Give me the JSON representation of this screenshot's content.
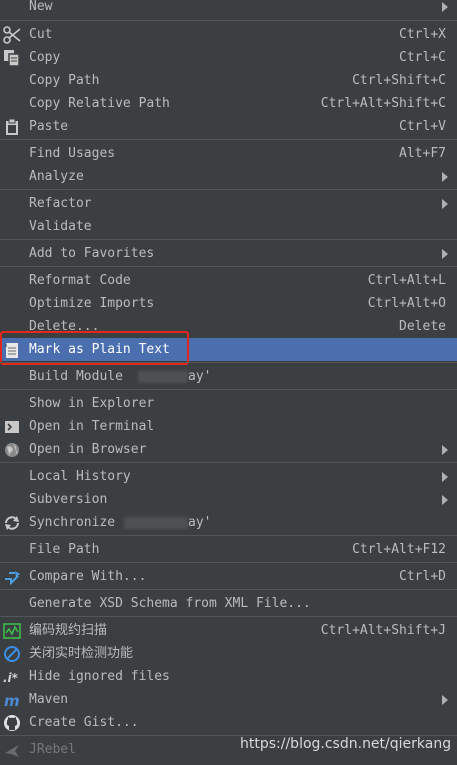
{
  "menu": {
    "items": [
      {
        "label": "New",
        "shortcut": "",
        "submenu": true
      },
      {
        "label": "Cut",
        "shortcut": "Ctrl+X",
        "icon": "scissors-icon"
      },
      {
        "label": "Copy",
        "shortcut": "Ctrl+C",
        "icon": "copy-icon"
      },
      {
        "label": "Copy Path",
        "shortcut": "Ctrl+Shift+C"
      },
      {
        "label": "Copy Relative Path",
        "shortcut": "Ctrl+Alt+Shift+C"
      },
      {
        "label": "Paste",
        "shortcut": "Ctrl+V",
        "icon": "clipboard-icon"
      },
      {
        "label": "Find Usages",
        "shortcut": "Alt+F7"
      },
      {
        "label": "Analyze",
        "shortcut": "",
        "submenu": true
      },
      {
        "label": "Refactor",
        "shortcut": "",
        "submenu": true
      },
      {
        "label": "Validate",
        "shortcut": ""
      },
      {
        "label": "Add to Favorites",
        "shortcut": "",
        "submenu": true
      },
      {
        "label": "Reformat Code",
        "shortcut": "Ctrl+Alt+L"
      },
      {
        "label": "Optimize Imports",
        "shortcut": "Ctrl+Alt+O"
      },
      {
        "label": "Delete...",
        "shortcut": "Delete"
      },
      {
        "label": "Mark as Plain Text",
        "shortcut": "",
        "icon": "plain-text-file-icon",
        "selected": true
      },
      {
        "label": "Build Module",
        "suffix": "ay'",
        "shortcut": ""
      },
      {
        "label": "Show in Explorer",
        "shortcut": ""
      },
      {
        "label": "Open in Terminal",
        "shortcut": "",
        "icon": "terminal-icon"
      },
      {
        "label": "Open in Browser",
        "shortcut": "",
        "icon": "globe-icon",
        "submenu": true
      },
      {
        "label": "Local History",
        "shortcut": "",
        "submenu": true
      },
      {
        "label": "Subversion",
        "shortcut": "",
        "submenu": true
      },
      {
        "label": "Synchronize",
        "suffix": "ay'",
        "shortcut": "",
        "icon": "sync-icon"
      },
      {
        "label": "File Path",
        "shortcut": "Ctrl+Alt+F12"
      },
      {
        "label": "Compare With...",
        "shortcut": "Ctrl+D",
        "icon": "compare-icon"
      },
      {
        "label": "Generate XSD Schema from XML File...",
        "shortcut": ""
      },
      {
        "label": "编码规约扫描",
        "shortcut": "Ctrl+Alt+Shift+J",
        "icon": "code-scan-icon"
      },
      {
        "label": "关闭实时检测功能",
        "shortcut": "",
        "icon": "disable-icon"
      },
      {
        "label": "Hide ignored files",
        "shortcut": "",
        "icon": "ignore-file-icon"
      },
      {
        "label": "Maven",
        "shortcut": "",
        "icon": "maven-icon",
        "submenu": true
      },
      {
        "label": "Create Gist...",
        "shortcut": "",
        "icon": "github-icon"
      },
      {
        "label": "JRebel",
        "shortcut": "",
        "icon": "jrebel-icon",
        "disabled": true
      }
    ]
  },
  "watermark": "https://blog.csdn.net/qierkang"
}
